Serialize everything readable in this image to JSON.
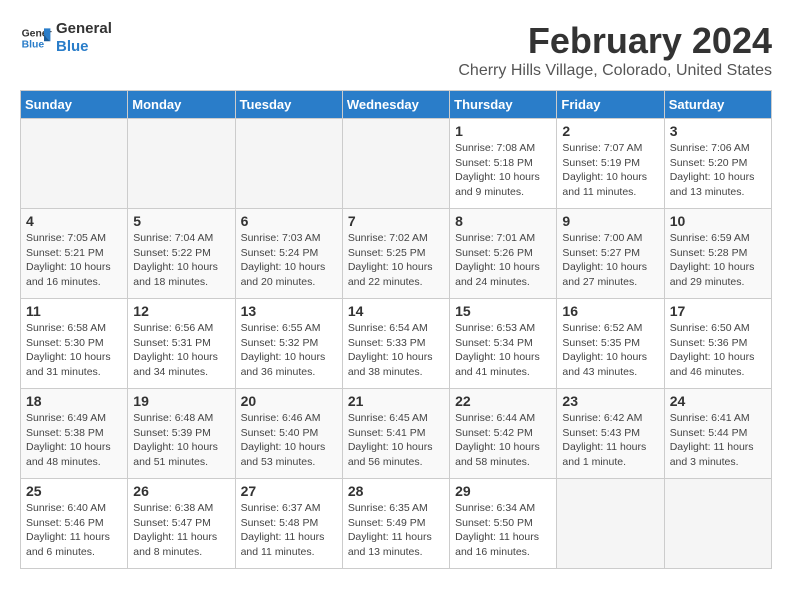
{
  "logo": {
    "line1": "General",
    "line2": "Blue"
  },
  "title": "February 2024",
  "subtitle": "Cherry Hills Village, Colorado, United States",
  "weekdays": [
    "Sunday",
    "Monday",
    "Tuesday",
    "Wednesday",
    "Thursday",
    "Friday",
    "Saturday"
  ],
  "weeks": [
    [
      {
        "day": "",
        "info": ""
      },
      {
        "day": "",
        "info": ""
      },
      {
        "day": "",
        "info": ""
      },
      {
        "day": "",
        "info": ""
      },
      {
        "day": "1",
        "info": "Sunrise: 7:08 AM\nSunset: 5:18 PM\nDaylight: 10 hours\nand 9 minutes."
      },
      {
        "day": "2",
        "info": "Sunrise: 7:07 AM\nSunset: 5:19 PM\nDaylight: 10 hours\nand 11 minutes."
      },
      {
        "day": "3",
        "info": "Sunrise: 7:06 AM\nSunset: 5:20 PM\nDaylight: 10 hours\nand 13 minutes."
      }
    ],
    [
      {
        "day": "4",
        "info": "Sunrise: 7:05 AM\nSunset: 5:21 PM\nDaylight: 10 hours\nand 16 minutes."
      },
      {
        "day": "5",
        "info": "Sunrise: 7:04 AM\nSunset: 5:22 PM\nDaylight: 10 hours\nand 18 minutes."
      },
      {
        "day": "6",
        "info": "Sunrise: 7:03 AM\nSunset: 5:24 PM\nDaylight: 10 hours\nand 20 minutes."
      },
      {
        "day": "7",
        "info": "Sunrise: 7:02 AM\nSunset: 5:25 PM\nDaylight: 10 hours\nand 22 minutes."
      },
      {
        "day": "8",
        "info": "Sunrise: 7:01 AM\nSunset: 5:26 PM\nDaylight: 10 hours\nand 24 minutes."
      },
      {
        "day": "9",
        "info": "Sunrise: 7:00 AM\nSunset: 5:27 PM\nDaylight: 10 hours\nand 27 minutes."
      },
      {
        "day": "10",
        "info": "Sunrise: 6:59 AM\nSunset: 5:28 PM\nDaylight: 10 hours\nand 29 minutes."
      }
    ],
    [
      {
        "day": "11",
        "info": "Sunrise: 6:58 AM\nSunset: 5:30 PM\nDaylight: 10 hours\nand 31 minutes."
      },
      {
        "day": "12",
        "info": "Sunrise: 6:56 AM\nSunset: 5:31 PM\nDaylight: 10 hours\nand 34 minutes."
      },
      {
        "day": "13",
        "info": "Sunrise: 6:55 AM\nSunset: 5:32 PM\nDaylight: 10 hours\nand 36 minutes."
      },
      {
        "day": "14",
        "info": "Sunrise: 6:54 AM\nSunset: 5:33 PM\nDaylight: 10 hours\nand 38 minutes."
      },
      {
        "day": "15",
        "info": "Sunrise: 6:53 AM\nSunset: 5:34 PM\nDaylight: 10 hours\nand 41 minutes."
      },
      {
        "day": "16",
        "info": "Sunrise: 6:52 AM\nSunset: 5:35 PM\nDaylight: 10 hours\nand 43 minutes."
      },
      {
        "day": "17",
        "info": "Sunrise: 6:50 AM\nSunset: 5:36 PM\nDaylight: 10 hours\nand 46 minutes."
      }
    ],
    [
      {
        "day": "18",
        "info": "Sunrise: 6:49 AM\nSunset: 5:38 PM\nDaylight: 10 hours\nand 48 minutes."
      },
      {
        "day": "19",
        "info": "Sunrise: 6:48 AM\nSunset: 5:39 PM\nDaylight: 10 hours\nand 51 minutes."
      },
      {
        "day": "20",
        "info": "Sunrise: 6:46 AM\nSunset: 5:40 PM\nDaylight: 10 hours\nand 53 minutes."
      },
      {
        "day": "21",
        "info": "Sunrise: 6:45 AM\nSunset: 5:41 PM\nDaylight: 10 hours\nand 56 minutes."
      },
      {
        "day": "22",
        "info": "Sunrise: 6:44 AM\nSunset: 5:42 PM\nDaylight: 10 hours\nand 58 minutes."
      },
      {
        "day": "23",
        "info": "Sunrise: 6:42 AM\nSunset: 5:43 PM\nDaylight: 11 hours\nand 1 minute."
      },
      {
        "day": "24",
        "info": "Sunrise: 6:41 AM\nSunset: 5:44 PM\nDaylight: 11 hours\nand 3 minutes."
      }
    ],
    [
      {
        "day": "25",
        "info": "Sunrise: 6:40 AM\nSunset: 5:46 PM\nDaylight: 11 hours\nand 6 minutes."
      },
      {
        "day": "26",
        "info": "Sunrise: 6:38 AM\nSunset: 5:47 PM\nDaylight: 11 hours\nand 8 minutes."
      },
      {
        "day": "27",
        "info": "Sunrise: 6:37 AM\nSunset: 5:48 PM\nDaylight: 11 hours\nand 11 minutes."
      },
      {
        "day": "28",
        "info": "Sunrise: 6:35 AM\nSunset: 5:49 PM\nDaylight: 11 hours\nand 13 minutes."
      },
      {
        "day": "29",
        "info": "Sunrise: 6:34 AM\nSunset: 5:50 PM\nDaylight: 11 hours\nand 16 minutes."
      },
      {
        "day": "",
        "info": ""
      },
      {
        "day": "",
        "info": ""
      }
    ]
  ]
}
